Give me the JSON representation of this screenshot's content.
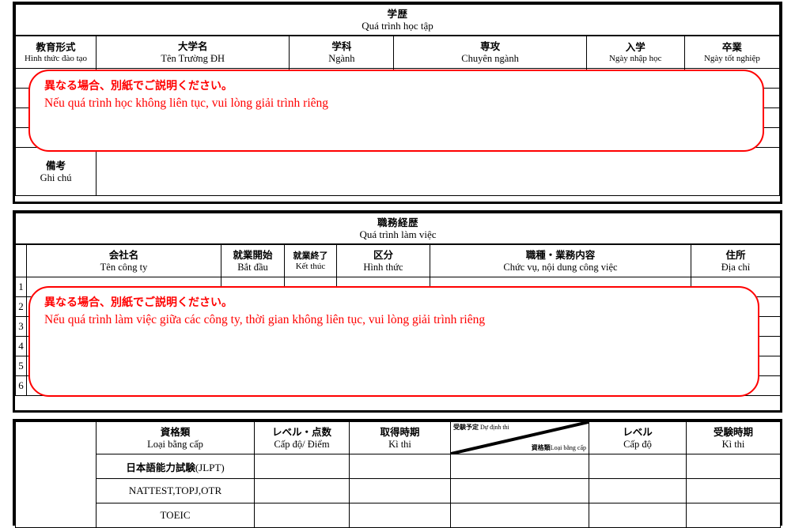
{
  "document": {
    "accent_red": "#ff0000",
    "header_fill": "#d9d9d9",
    "subheader_fill": "#f2f2f2"
  },
  "education": {
    "title_jp": "学歴",
    "title_vi": "Quá trình học tập",
    "columns": [
      {
        "jp": "教育形式",
        "vi": "Hình thức đào tạo"
      },
      {
        "jp": "大学名",
        "vi": "Tên Trường ĐH"
      },
      {
        "jp": "学科",
        "vi": "Ngành"
      },
      {
        "jp": "専攻",
        "vi": "Chuyên ngành"
      },
      {
        "jp": "入学",
        "vi": "Ngày nhập học"
      },
      {
        "jp": "卒業",
        "vi": "Ngày tốt nghiệp"
      }
    ],
    "rows": [
      [
        "",
        "",
        "",
        "",
        "",
        ""
      ],
      [
        "",
        "",
        "",
        "",
        "",
        ""
      ],
      [
        "",
        "",
        "",
        "",
        "",
        ""
      ],
      [
        "",
        "",
        "",
        "",
        "",
        ""
      ]
    ],
    "remark": {
      "jp": "備考",
      "vi": "Ghi chú",
      "value": ""
    },
    "callout": {
      "line_jp": "異なる場合、別紙でご説明ください。",
      "line_vi": "Nếu quá trình học không liên tục, vui lòng giải trình riêng"
    }
  },
  "work_history": {
    "title_jp": "職務経歴",
    "title_vi": "Quá trình làm việc",
    "columns": [
      {
        "jp": "会社名",
        "vi": "Tên công ty"
      },
      {
        "jp": "就業開始",
        "vi": "Bắt đầu"
      },
      {
        "jp": "就業終了",
        "vi": "Kết thúc"
      },
      {
        "jp": "区分",
        "vi": "Hình thức"
      },
      {
        "jp": "職種・業務内容",
        "vi": "Chức vụ, nội dung công việc"
      },
      {
        "jp": "住所",
        "vi": "Địa chỉ"
      }
    ],
    "row_numbers": [
      "1",
      "2",
      "3",
      "4",
      "5",
      "6"
    ],
    "callout": {
      "line_jp": "異なる場合、別紙でご説明ください。",
      "line_vi": "Nếu quá trình làm việc giữa các công ty, thời gian không liên tục, vui lòng giải trình riêng"
    }
  },
  "qualifications": {
    "columns": [
      {
        "jp": "資格類",
        "vi": "Loại bằng cấp"
      },
      {
        "jp": "レベル・点数",
        "vi": "Cấp độ/ Điểm"
      },
      {
        "jp": "取得時期",
        "vi": "Kì thi"
      },
      {
        "jp": "レベル",
        "vi": "Cấp độ"
      },
      {
        "jp": "受験時期",
        "vi": "Kì thi"
      }
    ],
    "diagonal_header": {
      "top_left_jp": "受験予定",
      "top_left_vi": "Dự định thi",
      "bottom_right_jp": "資格類",
      "bottom_right_vi": "Loại bằng cấp"
    },
    "rows": [
      {
        "name_jp": "日本語能力試験",
        "name_suffix": "(JLPT)",
        "level": "",
        "date": "",
        "plan_level": "",
        "plan_date": ""
      },
      {
        "name_jp": "",
        "name_suffix": "NATTEST,TOPJ,OTR",
        "level": "",
        "date": "",
        "plan_level": "",
        "plan_date": ""
      },
      {
        "name_jp": "",
        "name_suffix": "TOEIC",
        "level": "",
        "date": "",
        "plan_level": "",
        "plan_date": ""
      }
    ]
  }
}
